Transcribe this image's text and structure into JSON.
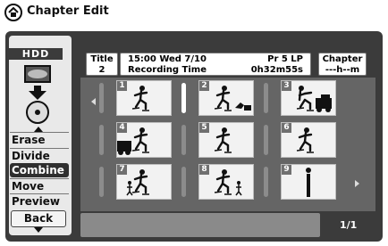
{
  "screen": {
    "title": "Chapter Edit"
  },
  "sidebar": {
    "drive_label": "HDD",
    "menu": [
      "Erase",
      "Divide",
      "Combine",
      "Move",
      "Preview"
    ],
    "selected": "Combine",
    "back_label": "Back"
  },
  "info": {
    "title_label": "Title",
    "title_number": "2",
    "datetime": "15:00 Wed  7/10",
    "program": "Pr 5  LP",
    "recording_time_label": "Recording Time",
    "recording_time": "0h32m55s",
    "chapter_label": "Chapter",
    "chapter_value": "---h--m"
  },
  "thumbnails": [
    {
      "num": "1",
      "scene": "skater"
    },
    {
      "num": "2",
      "scene": "skater-fallen-object"
    },
    {
      "num": "3",
      "scene": "skater-truck"
    },
    {
      "num": "4",
      "scene": "truck-skater"
    },
    {
      "num": "5",
      "scene": "skater"
    },
    {
      "num": "6",
      "scene": "skater"
    },
    {
      "num": "7",
      "scene": "small-figure-skater"
    },
    {
      "num": "8",
      "scene": "skater-small-figure"
    },
    {
      "num": "9",
      "scene": "standing-figure"
    }
  ],
  "selected_marker_index": 1,
  "page_indicator": "1/1",
  "icons": {
    "title": "chapter-edit-icon",
    "drive": "hdd-disc-icon",
    "nav_left": "arrow-left-icon",
    "nav_right": "arrow-right-icon"
  },
  "colors": {
    "panel": "#3b3b3b",
    "grid": "#656565",
    "selected": "#2f2f2f"
  }
}
